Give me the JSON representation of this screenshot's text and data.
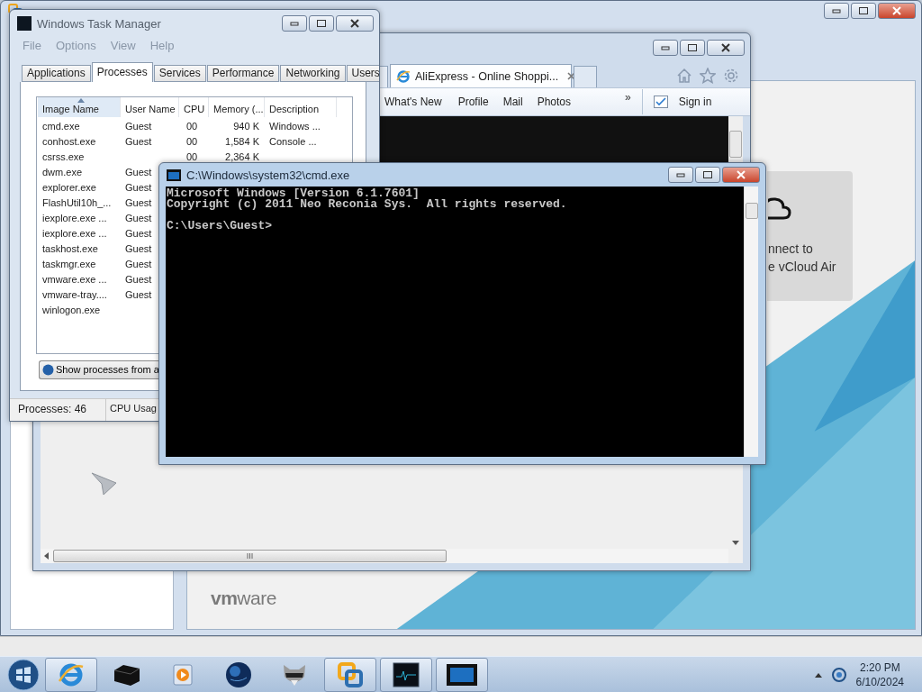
{
  "vmware_window": {
    "cloud_card": {
      "lines": [
        "nnect to",
        "e vCloud Air"
      ]
    },
    "logo": "**vm**ware"
  },
  "browser_window": {
    "tabs": [
      {
        "title": "AliExpress - Online Shoppi...",
        "selected": true
      }
    ],
    "favorites": [
      "What's New",
      "Profile",
      "Mail",
      "Photos"
    ],
    "overflow": "»",
    "sign_in": "Sign in"
  },
  "task_manager": {
    "title": "Windows Task Manager",
    "menu": [
      "File",
      "Options",
      "View",
      "Help"
    ],
    "tabs": [
      {
        "label": "Applications",
        "selected": false
      },
      {
        "label": "Processes",
        "selected": true
      },
      {
        "label": "Services",
        "selected": false
      },
      {
        "label": "Performance",
        "selected": false
      },
      {
        "label": "Networking",
        "selected": false
      },
      {
        "label": "Users",
        "selected": false
      }
    ],
    "columns": [
      "Image Name",
      "User Name",
      "CPU",
      "Memory (...",
      "Description"
    ],
    "rows": [
      {
        "image": "cmd.exe",
        "user": "Guest",
        "cpu": "00",
        "memory": "940 K",
        "description": "Windows ..."
      },
      {
        "image": "conhost.exe",
        "user": "Guest",
        "cpu": "00",
        "memory": "1,584 K",
        "description": "Console ..."
      },
      {
        "image": "csrss.exe",
        "cpu": "00",
        "memory": "2,364 K"
      },
      {
        "image": "dwm.exe",
        "user": "Guest"
      },
      {
        "image": "explorer.exe",
        "user": "Guest"
      },
      {
        "image": "FlashUtil10h_...",
        "user": "Guest"
      },
      {
        "image": "iexplore.exe ...",
        "user": "Guest"
      },
      {
        "image": "iexplore.exe ...",
        "user": "Guest"
      },
      {
        "image": "taskhost.exe",
        "user": "Guest"
      },
      {
        "image": "taskmgr.exe",
        "user": "Guest"
      },
      {
        "image": "vmware.exe ...",
        "user": "Guest"
      },
      {
        "image": "vmware-tray....",
        "user": "Guest"
      },
      {
        "image": "winlogon.exe"
      }
    ],
    "button": "Show processes from a",
    "status": [
      "Processes: 46",
      "CPU Usag"
    ]
  },
  "console": {
    "title": "C:\\Windows\\system32\\cmd.exe",
    "output": [
      "Microsoft Windows [Version 6.1.7601]",
      "Copyright (c) 2011 Neo Reconia Sys.  All rights reserved."
    ],
    "prompt": "C:\\Users\\Guest>"
  },
  "taskbar": {
    "apps": [
      {
        "kind": "browser",
        "running": true
      },
      {
        "kind": "box",
        "running": false
      },
      {
        "kind": "media",
        "running": false
      },
      {
        "kind": "globe",
        "running": false
      },
      {
        "kind": "raccoon",
        "running": false
      },
      {
        "kind": "vmware",
        "running": true
      },
      {
        "kind": "monitor",
        "running": true
      },
      {
        "kind": "console",
        "running": true
      }
    ],
    "clock": {
      "time": "2:20 PM",
      "date": "6/10/2024"
    }
  }
}
